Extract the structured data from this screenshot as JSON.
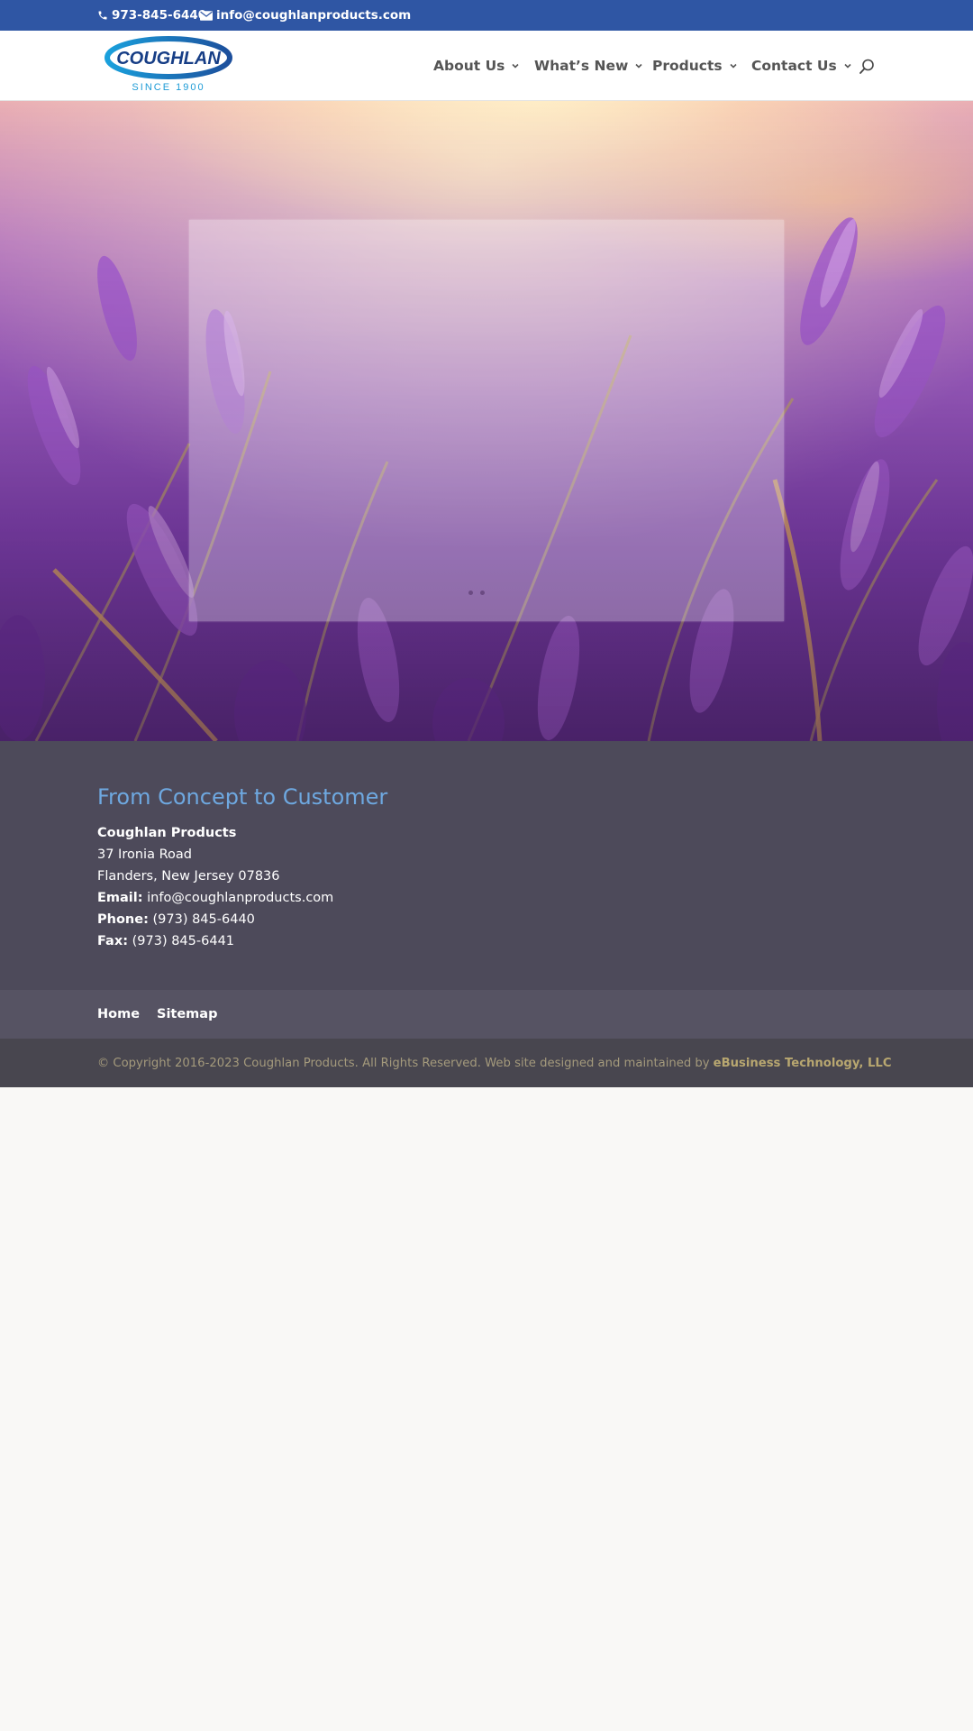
{
  "topbar": {
    "phone": "973-845-6440",
    "email": "info@coughlanproducts.com",
    "background": "#2f56a4"
  },
  "header": {
    "logo": {
      "name": "COUGHLAN",
      "tagline": "SINCE 1900"
    },
    "nav": [
      {
        "label": "About Us"
      },
      {
        "label": "What’s New"
      },
      {
        "label": "Products"
      },
      {
        "label": "Contact Us"
      }
    ]
  },
  "footer": {
    "heading": "From Concept to Customer",
    "company": "Coughlan Products",
    "address_line1": "37 Ironia Road",
    "address_line2": "Flanders, New Jersey 07836",
    "email_label": "Email:",
    "email_value": "info@coughlanproducts.com",
    "phone_label": "Phone:",
    "phone_value": "(973) 845-6440",
    "fax_label": "Fax:",
    "fax_value": "(973) 845-6441",
    "links": [
      {
        "label": "Home"
      },
      {
        "label": "Sitemap"
      }
    ],
    "copyright": "© Copyright 2016-2023 Coughlan Products. All Rights Reserved. Web site designed and maintained by",
    "designer": "eBusiness Technology, LLC"
  },
  "colors": {
    "accent_blue": "#2f56a4",
    "heading_blue": "#6ea8e0",
    "footer_bg": "#4d4a5a",
    "copyright_text": "#a49a7c"
  }
}
